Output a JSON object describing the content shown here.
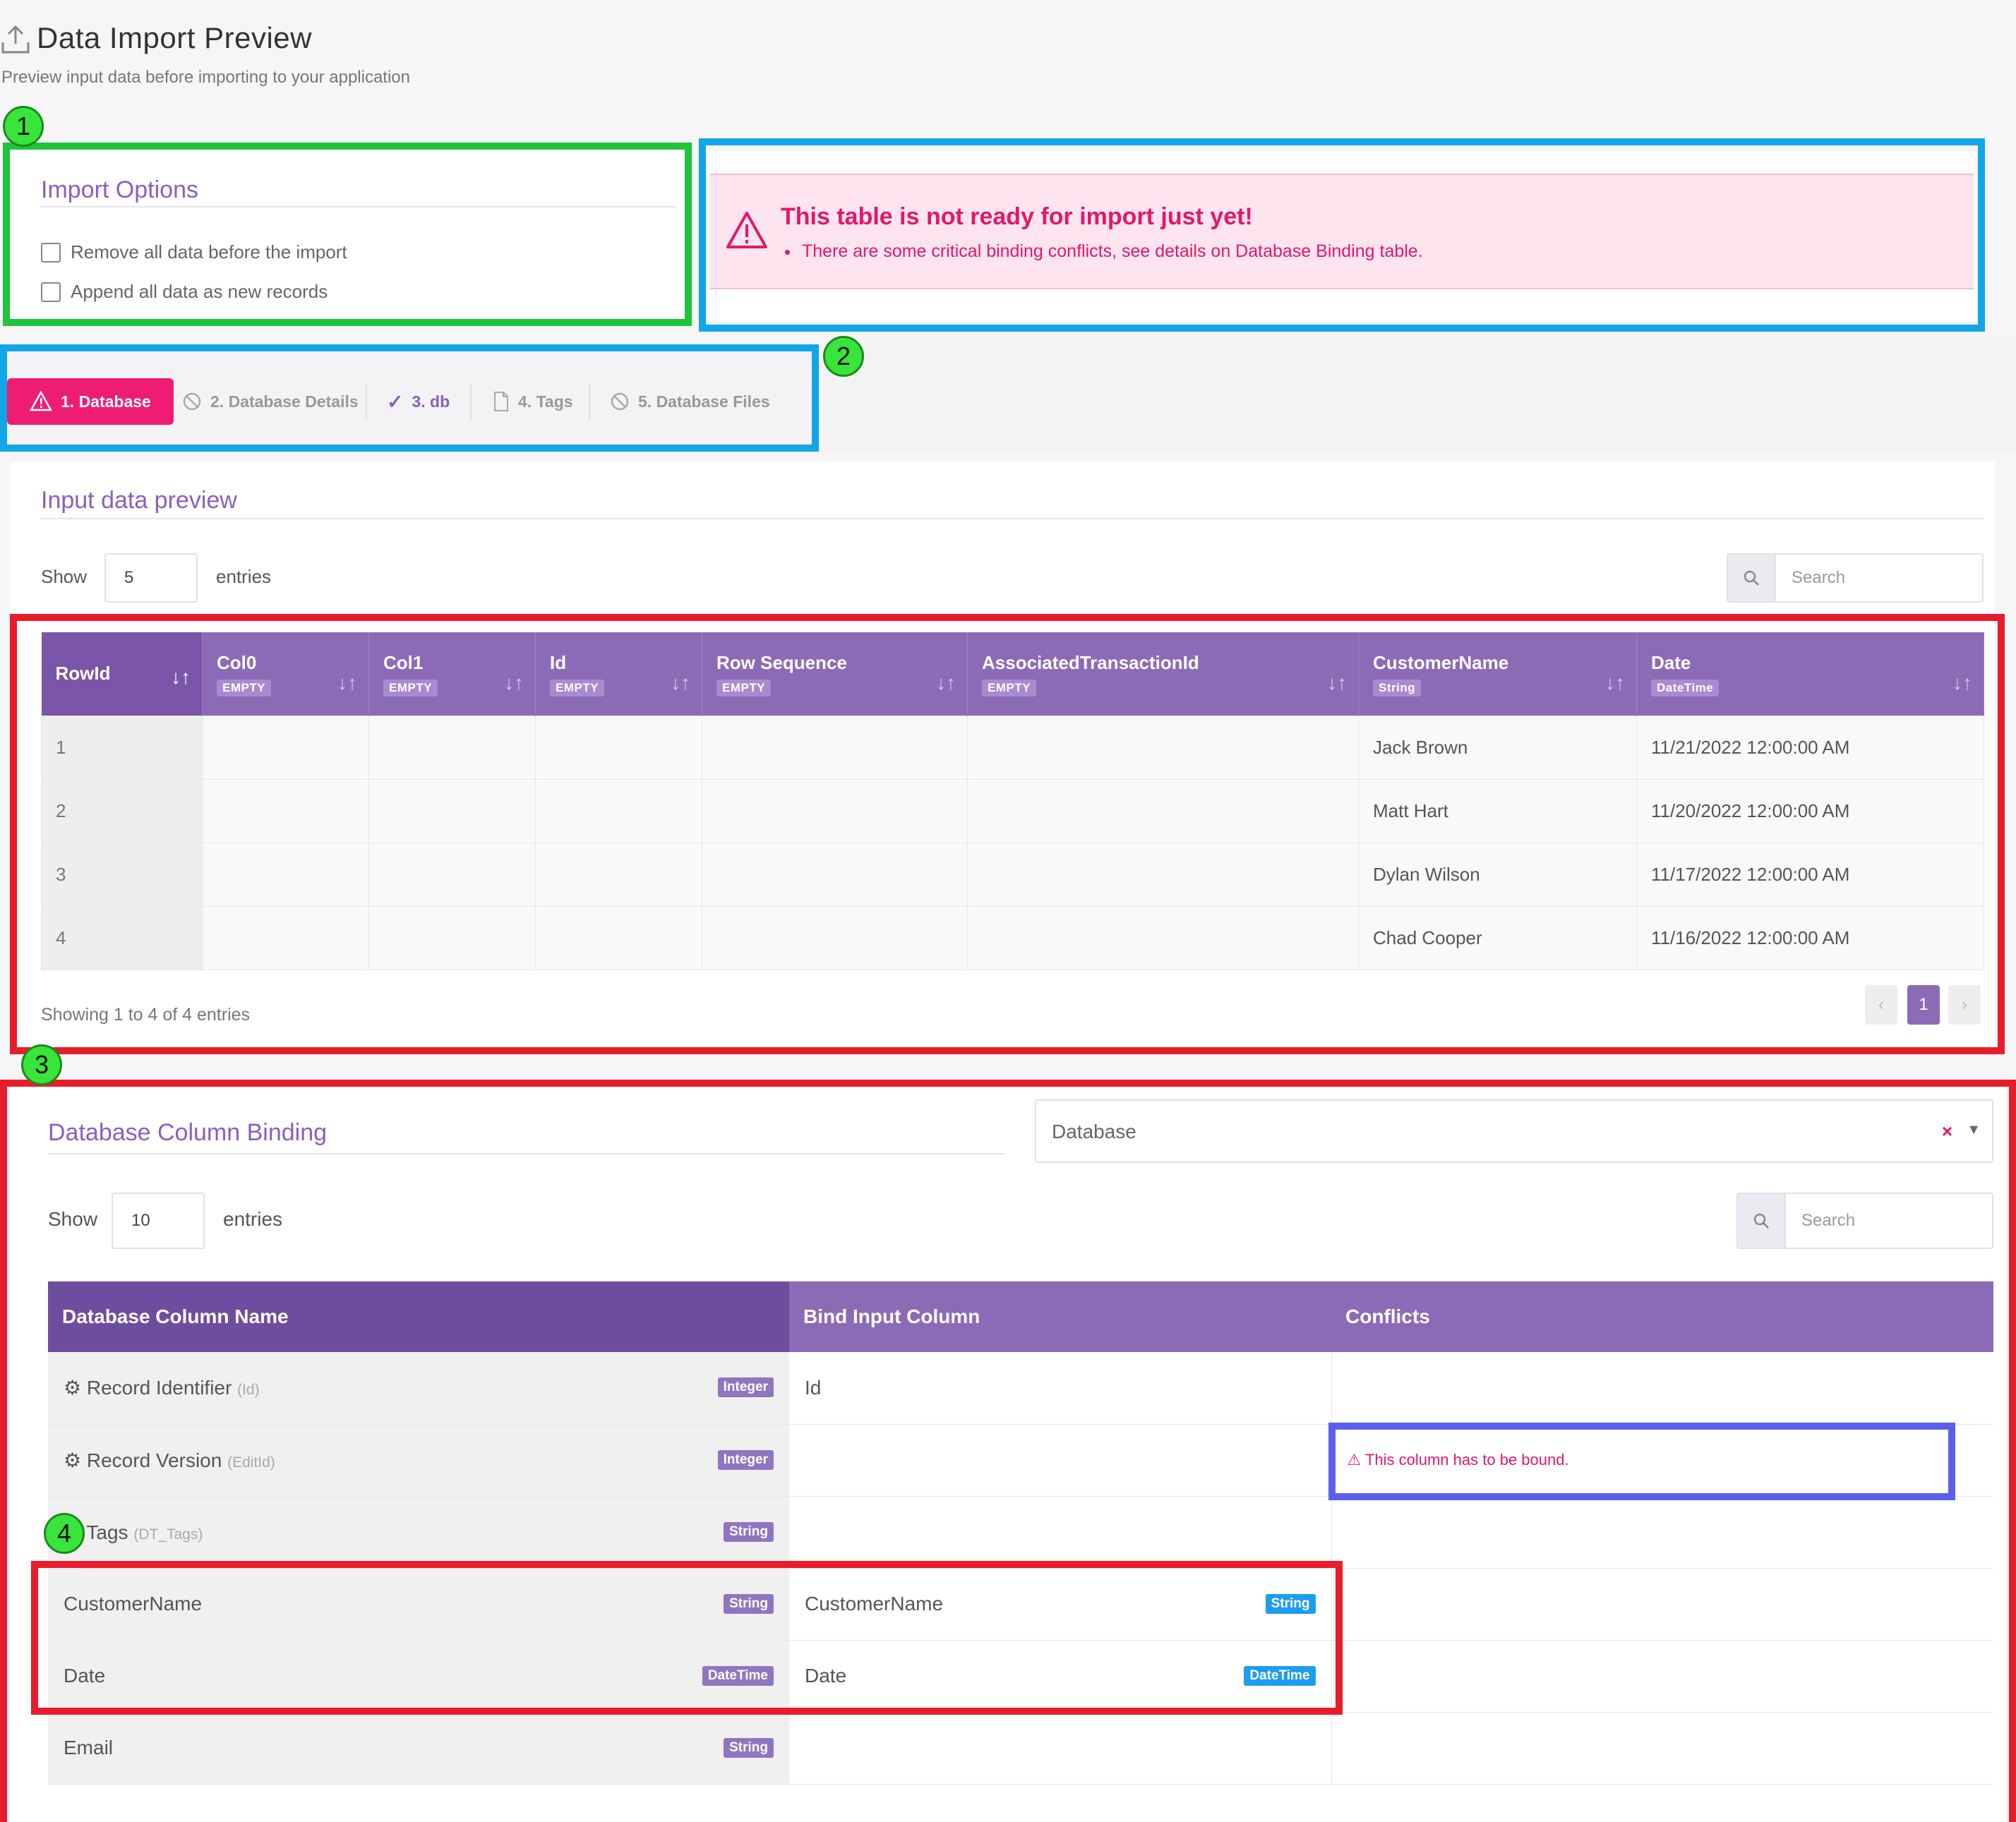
{
  "header": {
    "title": "Data Import Preview",
    "subtitle": "Preview input data before importing to your application"
  },
  "import_options": {
    "heading": "Import Options",
    "options": [
      {
        "label": "Remove all data before the import",
        "checked": false
      },
      {
        "label": "Append all data as new records",
        "checked": false
      }
    ]
  },
  "alert": {
    "title": "This table is not ready for import just yet!",
    "message": "There are some critical binding conflicts, see details on Database Binding table."
  },
  "tabs": [
    {
      "label": "1. Database",
      "icon": "warning-icon",
      "state": "active-error"
    },
    {
      "label": "2. Database Details",
      "icon": "ban-icon",
      "state": "disabled"
    },
    {
      "label": "3. db",
      "icon": "check-icon",
      "state": "done"
    },
    {
      "label": "4. Tags",
      "icon": "file-icon",
      "state": "default"
    },
    {
      "label": "5. Database Files",
      "icon": "ban-icon",
      "state": "disabled"
    }
  ],
  "preview": {
    "heading": "Input data preview",
    "show_label": "Show",
    "entries_value": "5",
    "entries_label": "entries",
    "search_placeholder": "Search",
    "columns": [
      {
        "name": "RowId",
        "type": ""
      },
      {
        "name": "Col0",
        "type": "EMPTY"
      },
      {
        "name": "Col1",
        "type": "EMPTY"
      },
      {
        "name": "Id",
        "type": "EMPTY"
      },
      {
        "name": "Row Sequence",
        "type": "EMPTY"
      },
      {
        "name": "AssociatedTransactionId",
        "type": "EMPTY"
      },
      {
        "name": "CustomerName",
        "type": "String"
      },
      {
        "name": "Date",
        "type": "DateTime"
      }
    ],
    "rows": [
      [
        "1",
        "",
        "",
        "",
        "",
        "",
        "Jack Brown",
        "11/21/2022 12:00:00 AM"
      ],
      [
        "2",
        "",
        "",
        "",
        "",
        "",
        "Matt Hart",
        "11/20/2022 12:00:00 AM"
      ],
      [
        "3",
        "",
        "",
        "",
        "",
        "",
        "Dylan Wilson",
        "11/17/2022 12:00:00 AM"
      ],
      [
        "4",
        "",
        "",
        "",
        "",
        "",
        "Chad Cooper",
        "11/16/2022 12:00:00 AM"
      ]
    ],
    "footer": "Showing 1 to 4 of 4 entries",
    "current_page": "1"
  },
  "binding": {
    "heading": "Database Column Binding",
    "select_value": "Database",
    "show_label": "Show",
    "entries_value": "10",
    "entries_label": "entries",
    "search_placeholder": "Search",
    "columns": [
      "Database Column Name",
      "Bind Input Column",
      "Conflicts"
    ],
    "rows": [
      {
        "name": "Record Identifier",
        "sub": "(Id)",
        "system": true,
        "type": "Integer",
        "bind": "Id",
        "bind_type": "",
        "conflict": ""
      },
      {
        "name": "Record Version",
        "sub": "(EditId)",
        "system": true,
        "type": "Integer",
        "bind": "",
        "bind_type": "",
        "conflict": "This column has to be bound."
      },
      {
        "name": "Tags",
        "sub": "(DT_Tags)",
        "system": true,
        "type": "String",
        "bind": "",
        "bind_type": "",
        "conflict": ""
      },
      {
        "name": "CustomerName",
        "sub": "",
        "system": false,
        "type": "String",
        "bind": "CustomerName",
        "bind_type": "String",
        "conflict": ""
      },
      {
        "name": "Date",
        "sub": "",
        "system": false,
        "type": "DateTime",
        "bind": "Date",
        "bind_type": "DateTime",
        "conflict": ""
      },
      {
        "name": "Email",
        "sub": "",
        "system": false,
        "type": "String",
        "bind": "",
        "bind_type": "",
        "conflict": ""
      }
    ]
  },
  "annotations": {
    "labels": [
      "1",
      "2",
      "3",
      "4"
    ],
    "colors": {
      "green": "#1fc43a",
      "blue": "#12a6e8",
      "red": "#e81c2b",
      "indigo": "#5a5ff0"
    }
  },
  "colors": {
    "accent": "#8c6bb6",
    "danger": "#ee1c72",
    "badge_blue": "#1e9cf0"
  }
}
